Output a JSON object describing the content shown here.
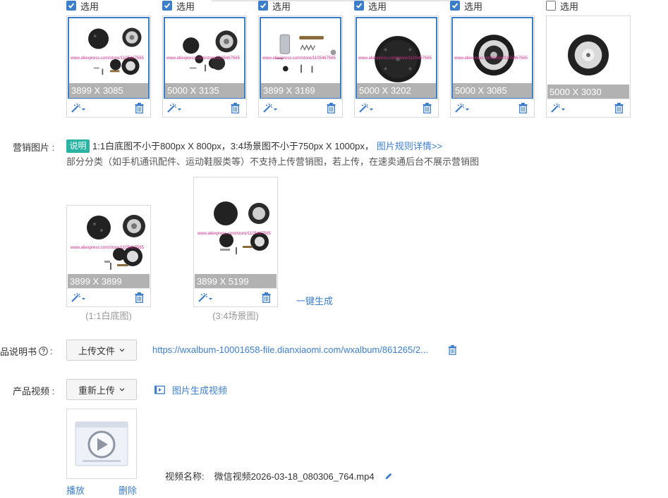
{
  "images": {
    "select_label": "选用",
    "items": [
      {
        "checked": true,
        "size": "3899 X 3085",
        "kind": "kit",
        "watermark": "www.aliexpress.com/store/1105467565"
      },
      {
        "checked": true,
        "size": "5000 X 3135",
        "kind": "kit2",
        "watermark": "www.aliexpress.com/store/1105467565"
      },
      {
        "checked": true,
        "size": "3899 X 3169",
        "kind": "parts",
        "watermark": "www.aliexpress.com/store/1105467565"
      },
      {
        "checked": true,
        "size": "5000 X 3202",
        "kind": "disc",
        "watermark": "www.aliexpress.com/store/1105467565"
      },
      {
        "checked": true,
        "size": "5000 X 3085",
        "kind": "gear",
        "watermark": "www.aliexpress.com/store/1105467565"
      },
      {
        "checked": false,
        "size": "5000 X 3030",
        "kind": "ring",
        "watermark": ""
      }
    ]
  },
  "marketing": {
    "label": "营销图片 :",
    "badge": "说明",
    "rule_text": "1:1白底图不小于800px X 800px，3:4场景图不小于750px X 1000px，",
    "rule_link": "图片规则详情>>",
    "note": "部分分类（如手机通讯配件、运动鞋服类等）不支持上传营销图，若上传，在速卖通后台不展示营销图",
    "square": {
      "size": "3899 X 3899",
      "caption": "(1:1白底图)"
    },
    "portrait": {
      "size": "3899 X 5199",
      "caption": "(3:4场景图)"
    },
    "generate": "一键生成"
  },
  "manual": {
    "label": "品说明书",
    "upload_button": "上传文件",
    "url": "https://wxalbum-10001658-file.dianxiaomi.com/wxalbum/861265/2..."
  },
  "video": {
    "label": "产品视频 :",
    "reupload_button": "重新上传",
    "generate_link": "图片生成视频",
    "name_label": "视频名称:",
    "name_value": "微信视频2026-03-18_080306_764.mp4",
    "play": "播放",
    "delete": "删除"
  },
  "colors": {
    "accent": "#3d7ecb",
    "badge": "#29b3a3"
  }
}
